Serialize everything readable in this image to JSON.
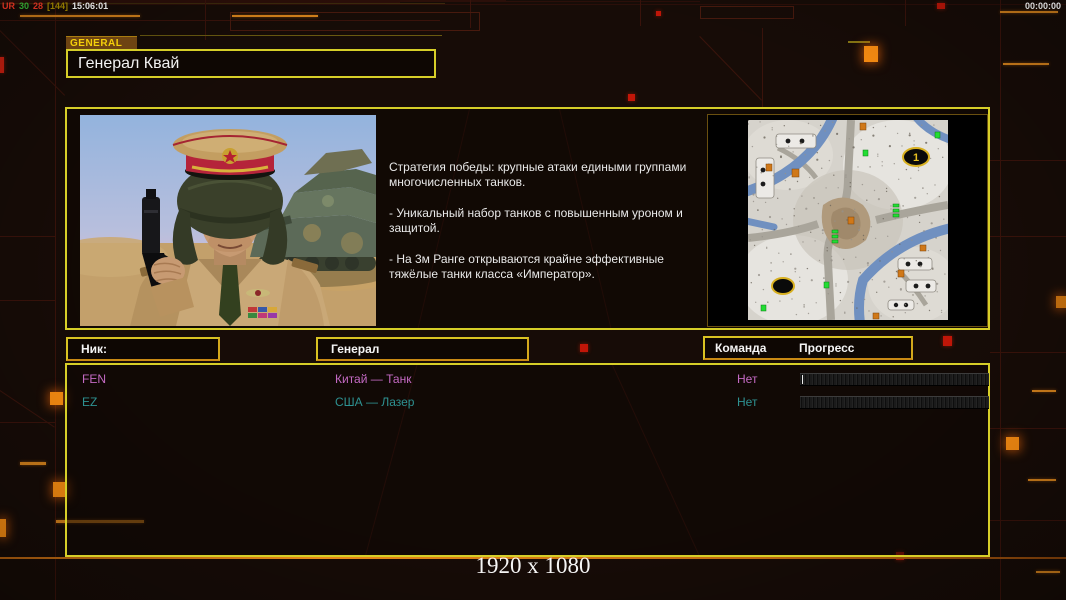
{
  "debug_bar": {
    "left_segments": [
      {
        "text": "UR",
        "color": "#d03020"
      },
      {
        "text": "30",
        "color": "#30a030"
      },
      {
        "text": "28",
        "color": "#d03020"
      },
      {
        "text": "[144]",
        "color": "#907800"
      },
      {
        "text": "15:06:01",
        "color": "#e0e0e0"
      }
    ],
    "right_timer": "00:00:00"
  },
  "header": {
    "tab_label": "GENERAL",
    "title": "Генерал Квай"
  },
  "general_info": {
    "description_paragraphs": [
      "Стратегия победы: крупные атаки едиными группами многочисленных танков.",
      "- Уникальный набор танков с повышенным уроном и защитой.",
      "- На 3м Ранге открываются крайне эффективные тяжёлые танки класса «Император»."
    ],
    "map": {
      "start_marker_label": "1"
    }
  },
  "lobby": {
    "columns": {
      "nick": "Ник:",
      "general": "Генерал",
      "team": "Команда",
      "progress": "Прогресс"
    },
    "players": [
      {
        "nick": "FEN",
        "general": "Китай — Танк",
        "team": "Нет",
        "progress_percent": 0,
        "color": "#c46ac4"
      },
      {
        "nick": "EZ",
        "general": "США — Лазер",
        "team": "Нет",
        "progress_percent": 0,
        "color": "#2e9292"
      }
    ]
  },
  "footer": {
    "resolution_label": "1920 x 1080"
  },
  "colors": {
    "accent_yellow": "#d6ce28",
    "accent_orange": "#d8841c",
    "glow_square": "#ff9012",
    "red_square": "#c21608"
  }
}
